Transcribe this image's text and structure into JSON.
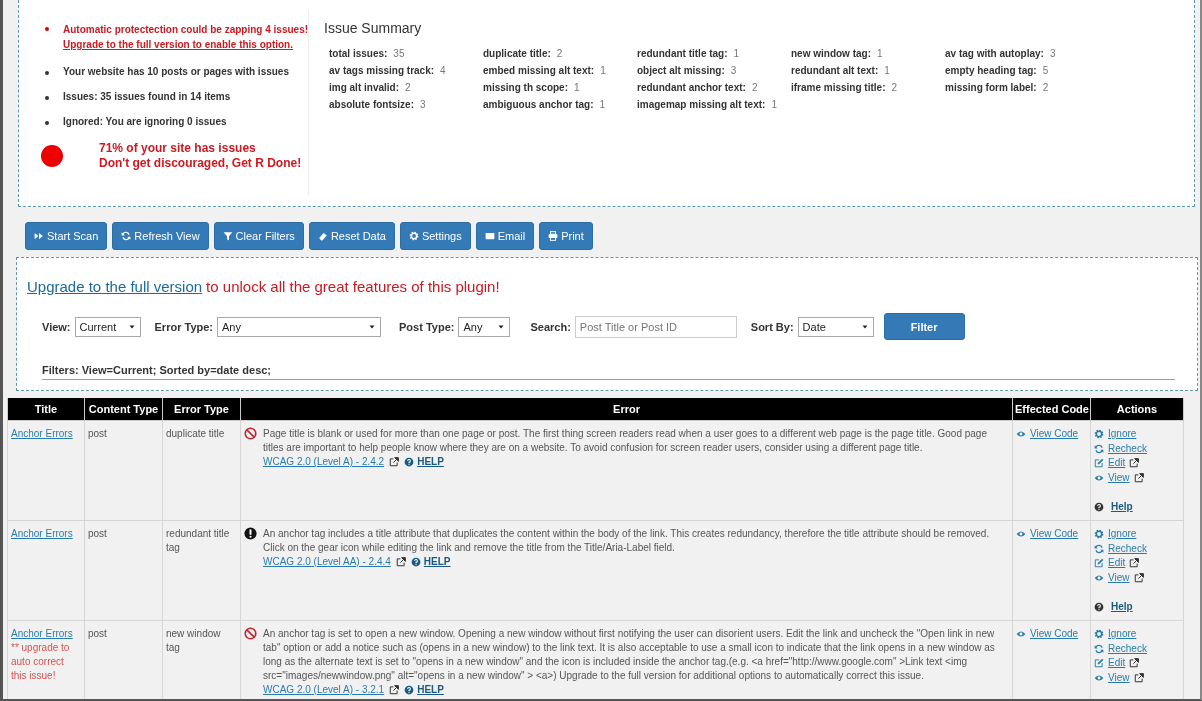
{
  "notices": {
    "alert": {
      "text": "Automatic protectection could be zapping 4 issues!",
      "link": "Upgrade to the full version to enable this option."
    },
    "items": [
      "Your website has 10 posts or pages with issues",
      "Issues: 35 issues found in 14 items",
      "Ignored: You are ignoring 0 issues"
    ],
    "status": {
      "lines": [
        "71% of your site has issues",
        "Don't get discouraged, Get R Done!"
      ]
    }
  },
  "issue_summary": {
    "title": "Issue Summary",
    "items": [
      {
        "label": "total issues:",
        "count": "35"
      },
      {
        "label": "duplicate title:",
        "count": "2"
      },
      {
        "label": "redundant title tag:",
        "count": "1"
      },
      {
        "label": "new window tag:",
        "count": "1"
      },
      {
        "label": "av tag with autoplay:",
        "count": "3"
      },
      {
        "label": "av tags missing track:",
        "count": "4"
      },
      {
        "label": "embed missing alt text:",
        "count": "1"
      },
      {
        "label": "object alt missing:",
        "count": "3"
      },
      {
        "label": "redundant alt text:",
        "count": "1"
      },
      {
        "label": "empty heading tag:",
        "count": "5"
      },
      {
        "label": "img alt invalid:",
        "count": "2"
      },
      {
        "label": "missing th scope:",
        "count": "1"
      },
      {
        "label": "redundant anchor text:",
        "count": "2"
      },
      {
        "label": "iframe missing title:",
        "count": "2"
      },
      {
        "label": "missing form label:",
        "count": "2"
      },
      {
        "label": "absolute fontsize:",
        "count": "3"
      },
      {
        "label": "ambiguous anchor tag:",
        "count": "1"
      },
      {
        "label": "imagemap missing alt text:",
        "count": "1"
      }
    ]
  },
  "toolbar": [
    "Start Scan",
    "Refresh View",
    "Clear Filters",
    "Reset Data",
    "Settings",
    "Email",
    "Print"
  ],
  "upgrade": {
    "link": "Upgrade to the full version",
    "text": "to unlock all the great features of this plugin!"
  },
  "filters": {
    "view": {
      "label": "View:",
      "value": "Current"
    },
    "error_type": {
      "label": "Error Type:",
      "value": "Any"
    },
    "post_type": {
      "label": "Post Type:",
      "value": "Any"
    },
    "search": {
      "label": "Search:",
      "placeholder": "Post Title or Post ID"
    },
    "sort_by": {
      "label": "Sort By:",
      "value": "Date"
    },
    "button": "Filter",
    "summary": "Filters: View=Current; Sorted by=date desc;"
  },
  "table": {
    "columns": [
      "Title",
      "Content Type",
      "Error Type",
      "Error",
      "Effected Code",
      "Actions"
    ],
    "rows": [
      {
        "title": "Anchor Errors",
        "content_type": "post",
        "error_type": "duplicate title",
        "kind": "error",
        "description": "Page title is blank or used for more than one page or post. The first thing screen readers read when a user goes to a different web page is the page title. Good page titles are important to help people know where they are on a website. To avoid confusion for screen reader users, consider using a different page title.",
        "wcag": "WCAG 2.0 (Level A) - 2.4.2",
        "help": "HELP",
        "code": "View Code",
        "actions": [
          "Ignore",
          "Recheck",
          "Edit",
          "View",
          "Help"
        ]
      },
      {
        "title": "Anchor Errors",
        "content_type": "post",
        "error_type": "redundant title tag",
        "kind": "warning",
        "description": "An anchor tag includes a title attribute that duplicates the content within the body of the link. This creates redundancy, therefore the title attribute should be removed. Click on the gear icon while editing the link and remove the title from the Title/Aria-Label field.",
        "wcag": "WCAG 2.0 (Level AA) - 2.4.4",
        "help": "HELP",
        "code": "View Code",
        "actions": [
          "Ignore",
          "Recheck",
          "Edit",
          "View",
          "Help"
        ]
      },
      {
        "title": "Anchor Errors",
        "note": "** upgrade to auto correct this issue!",
        "content_type": "post",
        "error_type": "new window tag",
        "kind": "error",
        "description": "An anchor tag is set to open a new window. Opening a new window without first notifying the user can disorient users. Edit the link and uncheck the \"Open link in new tab\" option or add a notice such as (opens in a new window) to the link text. It is also acceptable to use a small icon to indicate that the link opens in a new window as long as the alternate text is set to \"opens in a new window\" and the icon is included inside the anchor tag.(e.g. <a href=\"http://www.google.com\" >Link text <img src=\"images/newwindow.png\" alt=\"opens in a new window\" > <a>) Upgrade to the full version for additional options to automatically correct this issue.",
        "wcag": "WCAG 2.0 (Level A) - 3.2.1",
        "help": "HELP",
        "code": "View Code",
        "actions": [
          "Ignore",
          "Recheck",
          "Edit",
          "View"
        ]
      }
    ]
  }
}
